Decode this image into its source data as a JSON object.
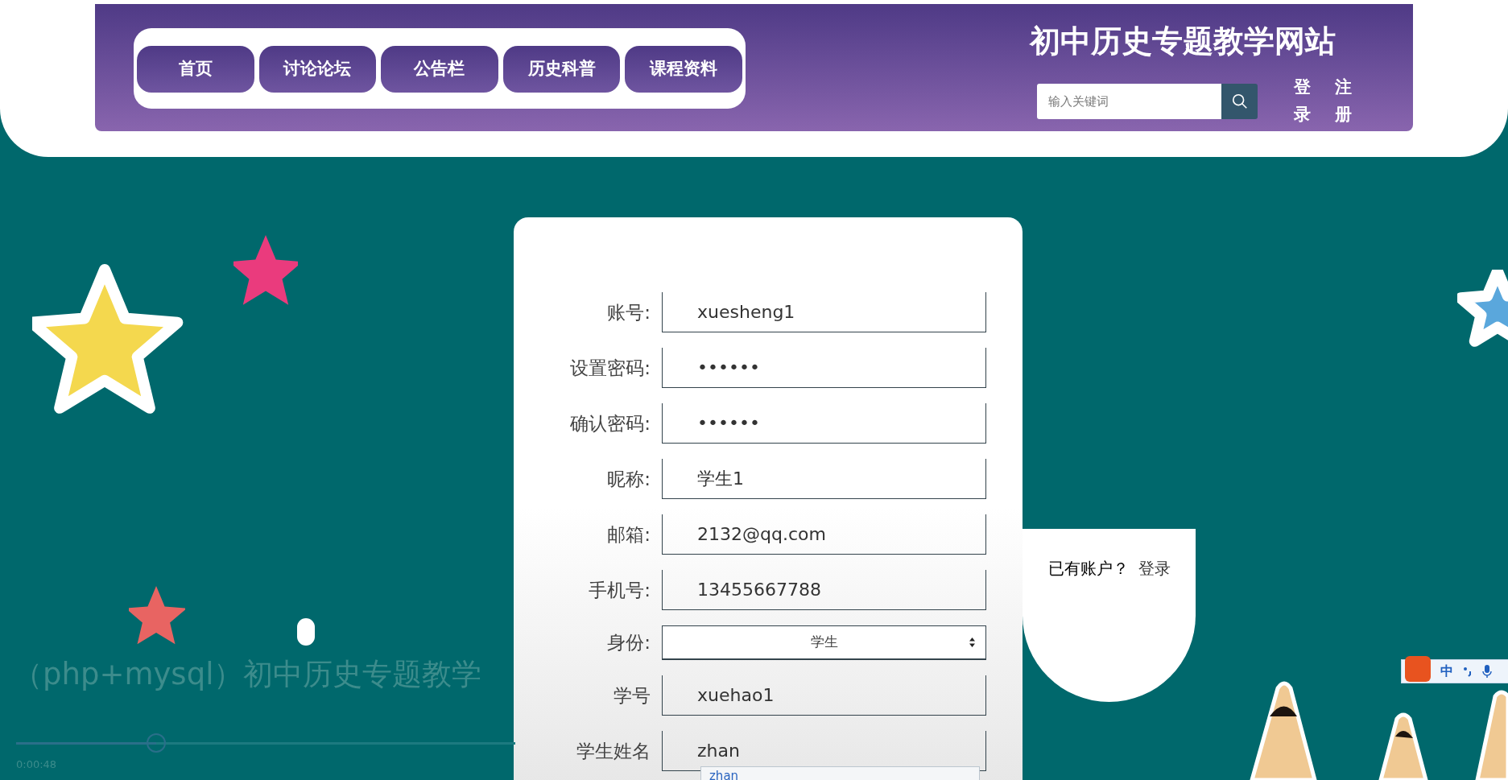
{
  "nav": {
    "items": [
      {
        "label": "首页"
      },
      {
        "label": "讨论论坛"
      },
      {
        "label": "公告栏"
      },
      {
        "label": "历史科普"
      },
      {
        "label": "课程资料"
      }
    ]
  },
  "site_title": "初中历史专题教学网站",
  "search": {
    "placeholder": "输入关键词"
  },
  "auth_links": [
    "登录",
    "注册"
  ],
  "form": {
    "fields": [
      {
        "kind": "text",
        "label": "账号:",
        "value": "xuesheng1"
      },
      {
        "kind": "text",
        "label": "设置密码:",
        "value": "••••••"
      },
      {
        "kind": "text",
        "label": "确认密码:",
        "value": "••••••"
      },
      {
        "kind": "text",
        "label": "昵称:",
        "value": "学生1"
      },
      {
        "kind": "text",
        "label": "邮箱:",
        "value": "2132@qq.com"
      },
      {
        "kind": "text",
        "label": "手机号:",
        "value": "13455667788"
      },
      {
        "kind": "select",
        "label": "身份:",
        "value": "学生"
      },
      {
        "kind": "text",
        "label": "学号",
        "value": "xuehao1"
      },
      {
        "kind": "text",
        "label": "学生姓名",
        "value": "zhan"
      }
    ],
    "ime_candidate": "zhan"
  },
  "login_prompt": {
    "text": "已有账户？",
    "link": "登录"
  },
  "video": {
    "title": "（php+mysql）初中历史专题教学",
    "time": "0:00:48",
    "progress": {
      "level": 0.28
    }
  },
  "ime_bar": {
    "mode": "中"
  }
}
